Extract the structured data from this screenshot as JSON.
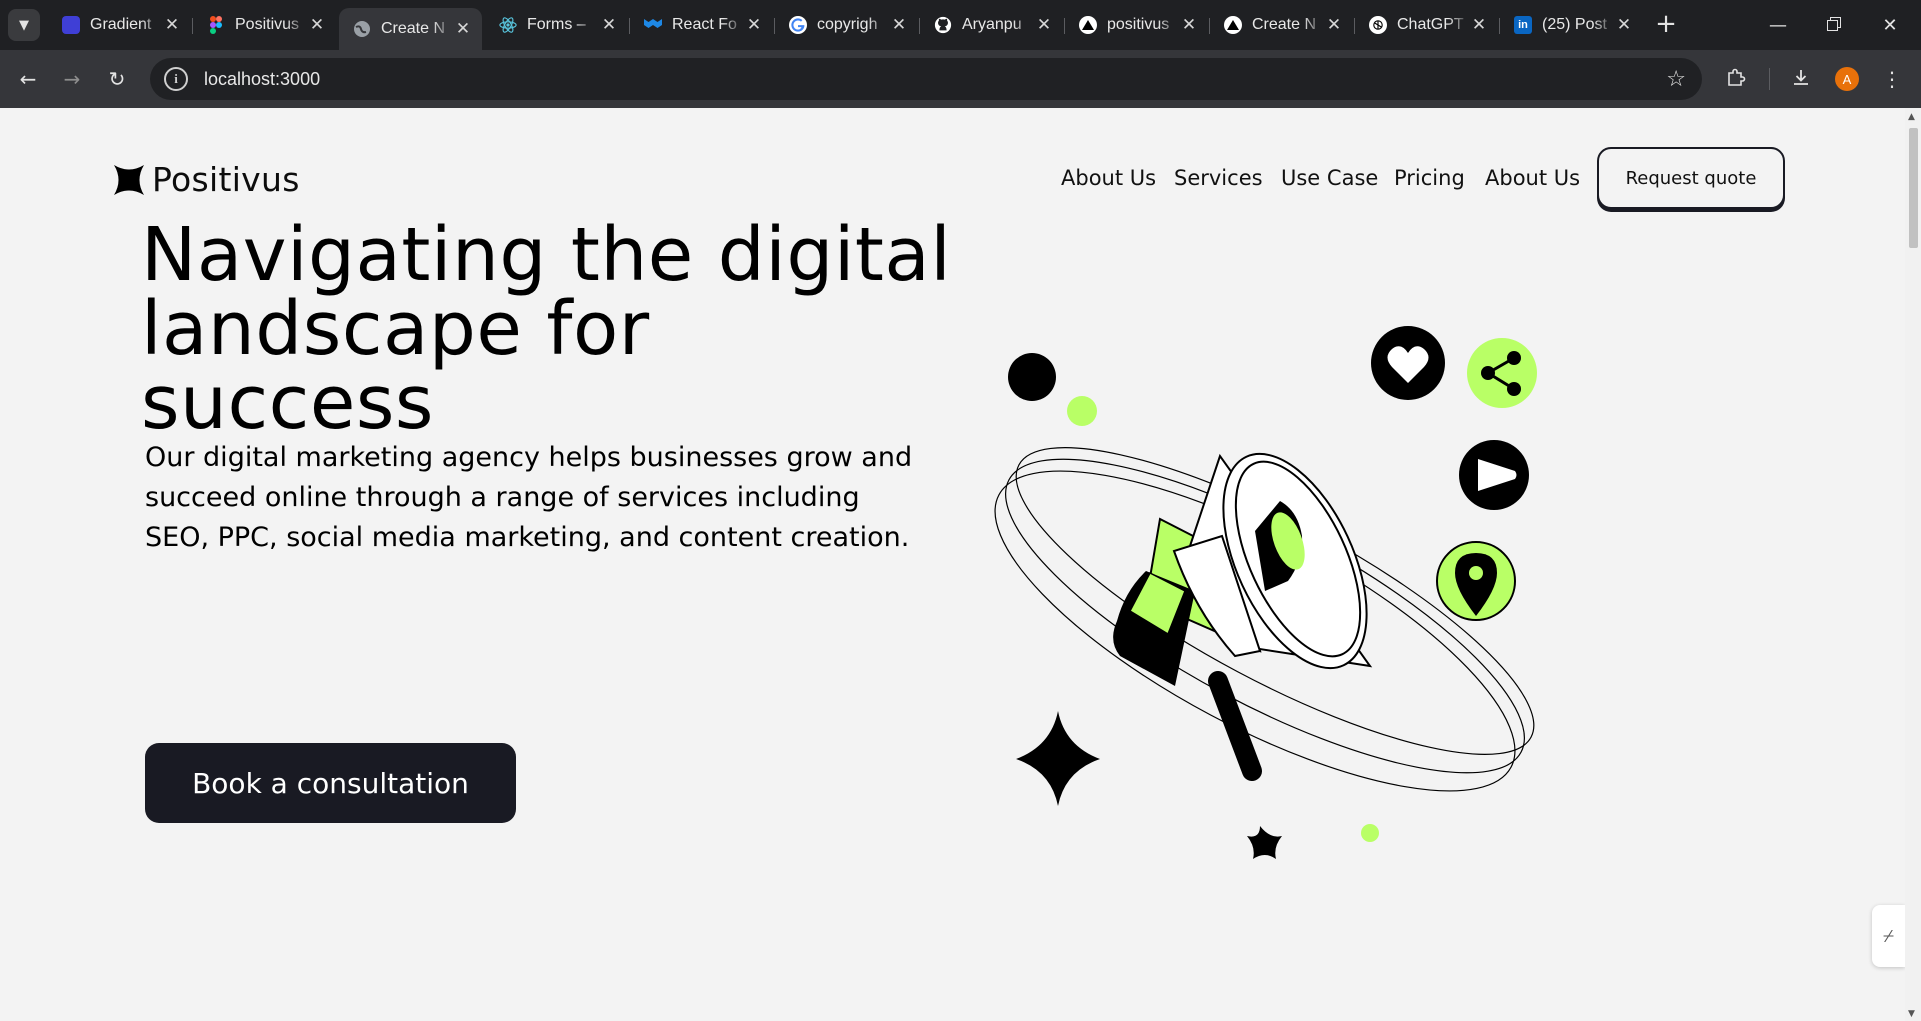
{
  "browser": {
    "tabs": [
      {
        "title": "Gradient",
        "favicon": "gradient-icon",
        "active": false
      },
      {
        "title": "Positivus",
        "favicon": "figma-icon",
        "active": false
      },
      {
        "title": "Create N",
        "favicon": "globe-icon",
        "active": true
      },
      {
        "title": "Forms –",
        "favicon": "react-icon",
        "active": false
      },
      {
        "title": "React Fo",
        "favicon": "mui-icon",
        "active": false
      },
      {
        "title": "copyrigh",
        "favicon": "google-icon",
        "active": false
      },
      {
        "title": "Aryanpu",
        "favicon": "github-icon",
        "active": false
      },
      {
        "title": "positivus",
        "favicon": "vercel-icon",
        "active": false
      },
      {
        "title": "Create N",
        "favicon": "vercel-icon",
        "active": false
      },
      {
        "title": "ChatGPT",
        "favicon": "chatgpt-icon",
        "active": false
      },
      {
        "title": "(25) Post",
        "favicon": "linkedin-icon",
        "active": false
      }
    ],
    "url": "localhost:3000",
    "profile_initial": "A",
    "profile_color": "#e8710a"
  },
  "site": {
    "logo_text": "Positivus",
    "nav": [
      "About Us",
      "Services",
      "Use Case",
      "Pricing",
      "About Us"
    ],
    "quote_button": "Request quote",
    "hero_title": "Navigating the digital landscape for success",
    "hero_subtitle": "Our digital marketing agency helps businesses grow and succeed online through a range of services including SEO, PPC, social media marketing, and content creation.",
    "cta_button": "Book a consultation"
  },
  "colors": {
    "accent_green": "#b9ff66",
    "dark": "#191a23",
    "background": "#f3f3f3"
  }
}
